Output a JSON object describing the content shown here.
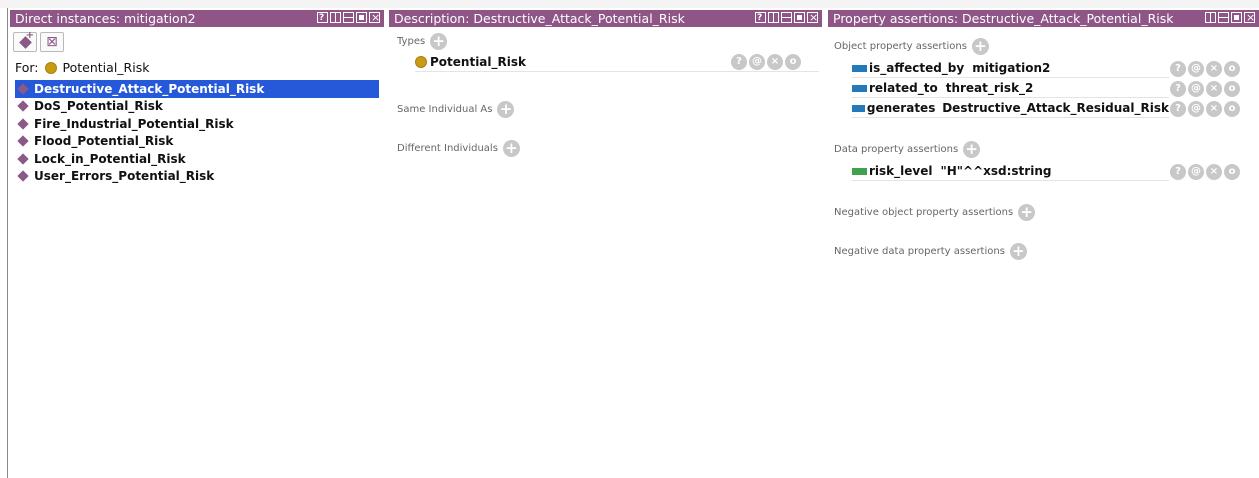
{
  "panels": {
    "instances": {
      "title": "Direct instances: mitigation2",
      "for_label": "For:",
      "for_class": "Potential_Risk",
      "items": [
        {
          "label": "Destructive_Attack_Potential_Risk",
          "selected": true
        },
        {
          "label": "DoS_Potential_Risk"
        },
        {
          "label": "Fire_Industrial_Potential_Risk"
        },
        {
          "label": "Flood_Potential_Risk"
        },
        {
          "label": "Lock_in_Potential_Risk"
        },
        {
          "label": "User_Errors_Potential_Risk"
        }
      ]
    },
    "description": {
      "title": "Description: Destructive_Attack_Potential_Risk",
      "types_label": "Types",
      "type_value": "Potential_Risk",
      "same_individual_label": "Same Individual As",
      "different_individuals_label": "Different Individuals"
    },
    "properties": {
      "title": "Property assertions: Destructive_Attack_Potential_Risk",
      "object_label": "Object property assertions",
      "object_rows": [
        {
          "property": "is_affected_by",
          "value": "mitigation2"
        },
        {
          "property": "related_to",
          "value": "threat_risk_2"
        },
        {
          "property": "generates",
          "value": "Destructive_Attack_Residual_Risk"
        }
      ],
      "data_label": "Data property assertions",
      "data_rows": [
        {
          "property": "risk_level",
          "value": "\"H\"^^xsd:string"
        }
      ],
      "neg_object_label": "Negative object property assertions",
      "neg_data_label": "Negative data property assertions"
    }
  },
  "icons": {
    "add": "+",
    "help": "?",
    "annotate": "@",
    "delete": "×",
    "edit": "o"
  },
  "colors": {
    "title_bar": "#8f5587",
    "selection": "#2559d9",
    "individual": "#8a5a86",
    "class": "#c89b12",
    "object_property": "#2379b9",
    "data_property": "#3fa14c"
  }
}
